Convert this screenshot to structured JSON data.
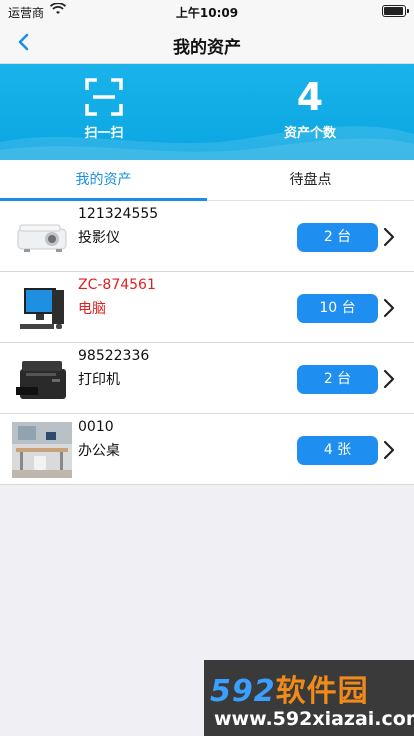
{
  "status_bar": {
    "carrier": "运营商",
    "time": "上午10:09"
  },
  "nav": {
    "title": "我的资产",
    "back_icon": "chevron-left-icon"
  },
  "banner": {
    "scan_label": "扫一扫",
    "count_value": "4",
    "count_label": "资产个数",
    "colors": {
      "background": "#0aa6e2"
    }
  },
  "tabs": [
    {
      "label": "我的资产",
      "active": true
    },
    {
      "label": "待盘点",
      "active": false
    }
  ],
  "assets": [
    {
      "code": "121324555",
      "name": "投影仪",
      "quantity": "2 台",
      "image": "projector-image",
      "highlight": false
    },
    {
      "code": "ZC-874561",
      "name": "电脑",
      "quantity": "10 台",
      "image": "computer-image",
      "highlight": true
    },
    {
      "code": "98522336",
      "name": "打印机",
      "quantity": "2 台",
      "image": "printer-image",
      "highlight": false
    },
    {
      "code": "0010",
      "name": "办公桌",
      "quantity": "4 张",
      "image": "desk-image",
      "highlight": false
    }
  ],
  "accent_color": "#1e8ef0",
  "highlight_color": "#e02020",
  "watermark": {
    "brand_digits": "592",
    "brand_text": "软件园",
    "url": "www.592xiazai.com"
  }
}
